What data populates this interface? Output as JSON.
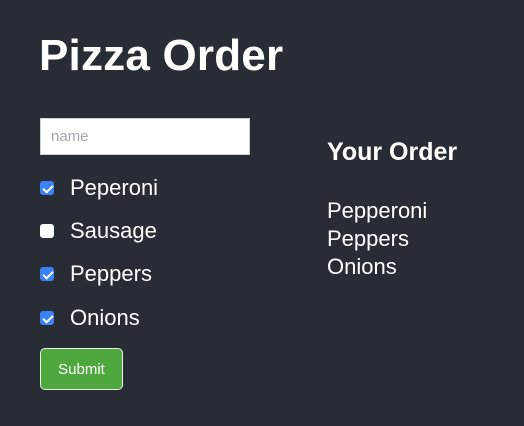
{
  "header": {
    "title": "Pizza Order"
  },
  "form": {
    "name_placeholder": "name",
    "name_value": "",
    "toppings": [
      {
        "label": "Peperoni",
        "checked": true
      },
      {
        "label": "Sausage",
        "checked": false
      },
      {
        "label": "Peppers",
        "checked": true
      },
      {
        "label": "Onions",
        "checked": true
      }
    ],
    "submit_label": "Submit"
  },
  "summary": {
    "heading": "Your Order",
    "items": [
      "Pepperoni",
      "Peppers",
      "Onions"
    ]
  },
  "colors": {
    "background": "#282c35",
    "checkbox_checked": "#3b82f6",
    "submit_button": "#4ea83d"
  }
}
